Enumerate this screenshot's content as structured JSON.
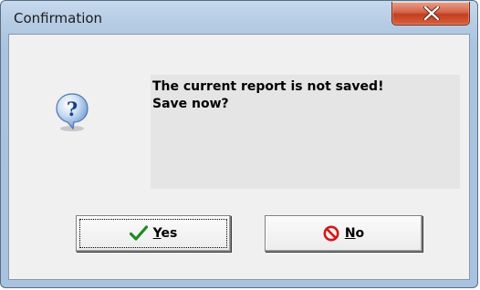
{
  "dialog": {
    "title": "Confirmation",
    "close_icon": "close-x-icon",
    "message_icon": "question-icon",
    "message_line1": "The current report is not saved!",
    "message_line2": "Save now?",
    "buttons": {
      "yes": {
        "mnemonic": "Y",
        "rest": "es",
        "icon": "checkmark-icon",
        "icon_color": "#1f8a1f",
        "focused": true
      },
      "no": {
        "mnemonic": "N",
        "rest": "o",
        "icon": "prohibited-icon",
        "icon_color": "#d11818"
      }
    }
  },
  "colors": {
    "close_button": "#c8452a",
    "frame": "#aac3df",
    "message_panel": "#e5e5e5"
  }
}
